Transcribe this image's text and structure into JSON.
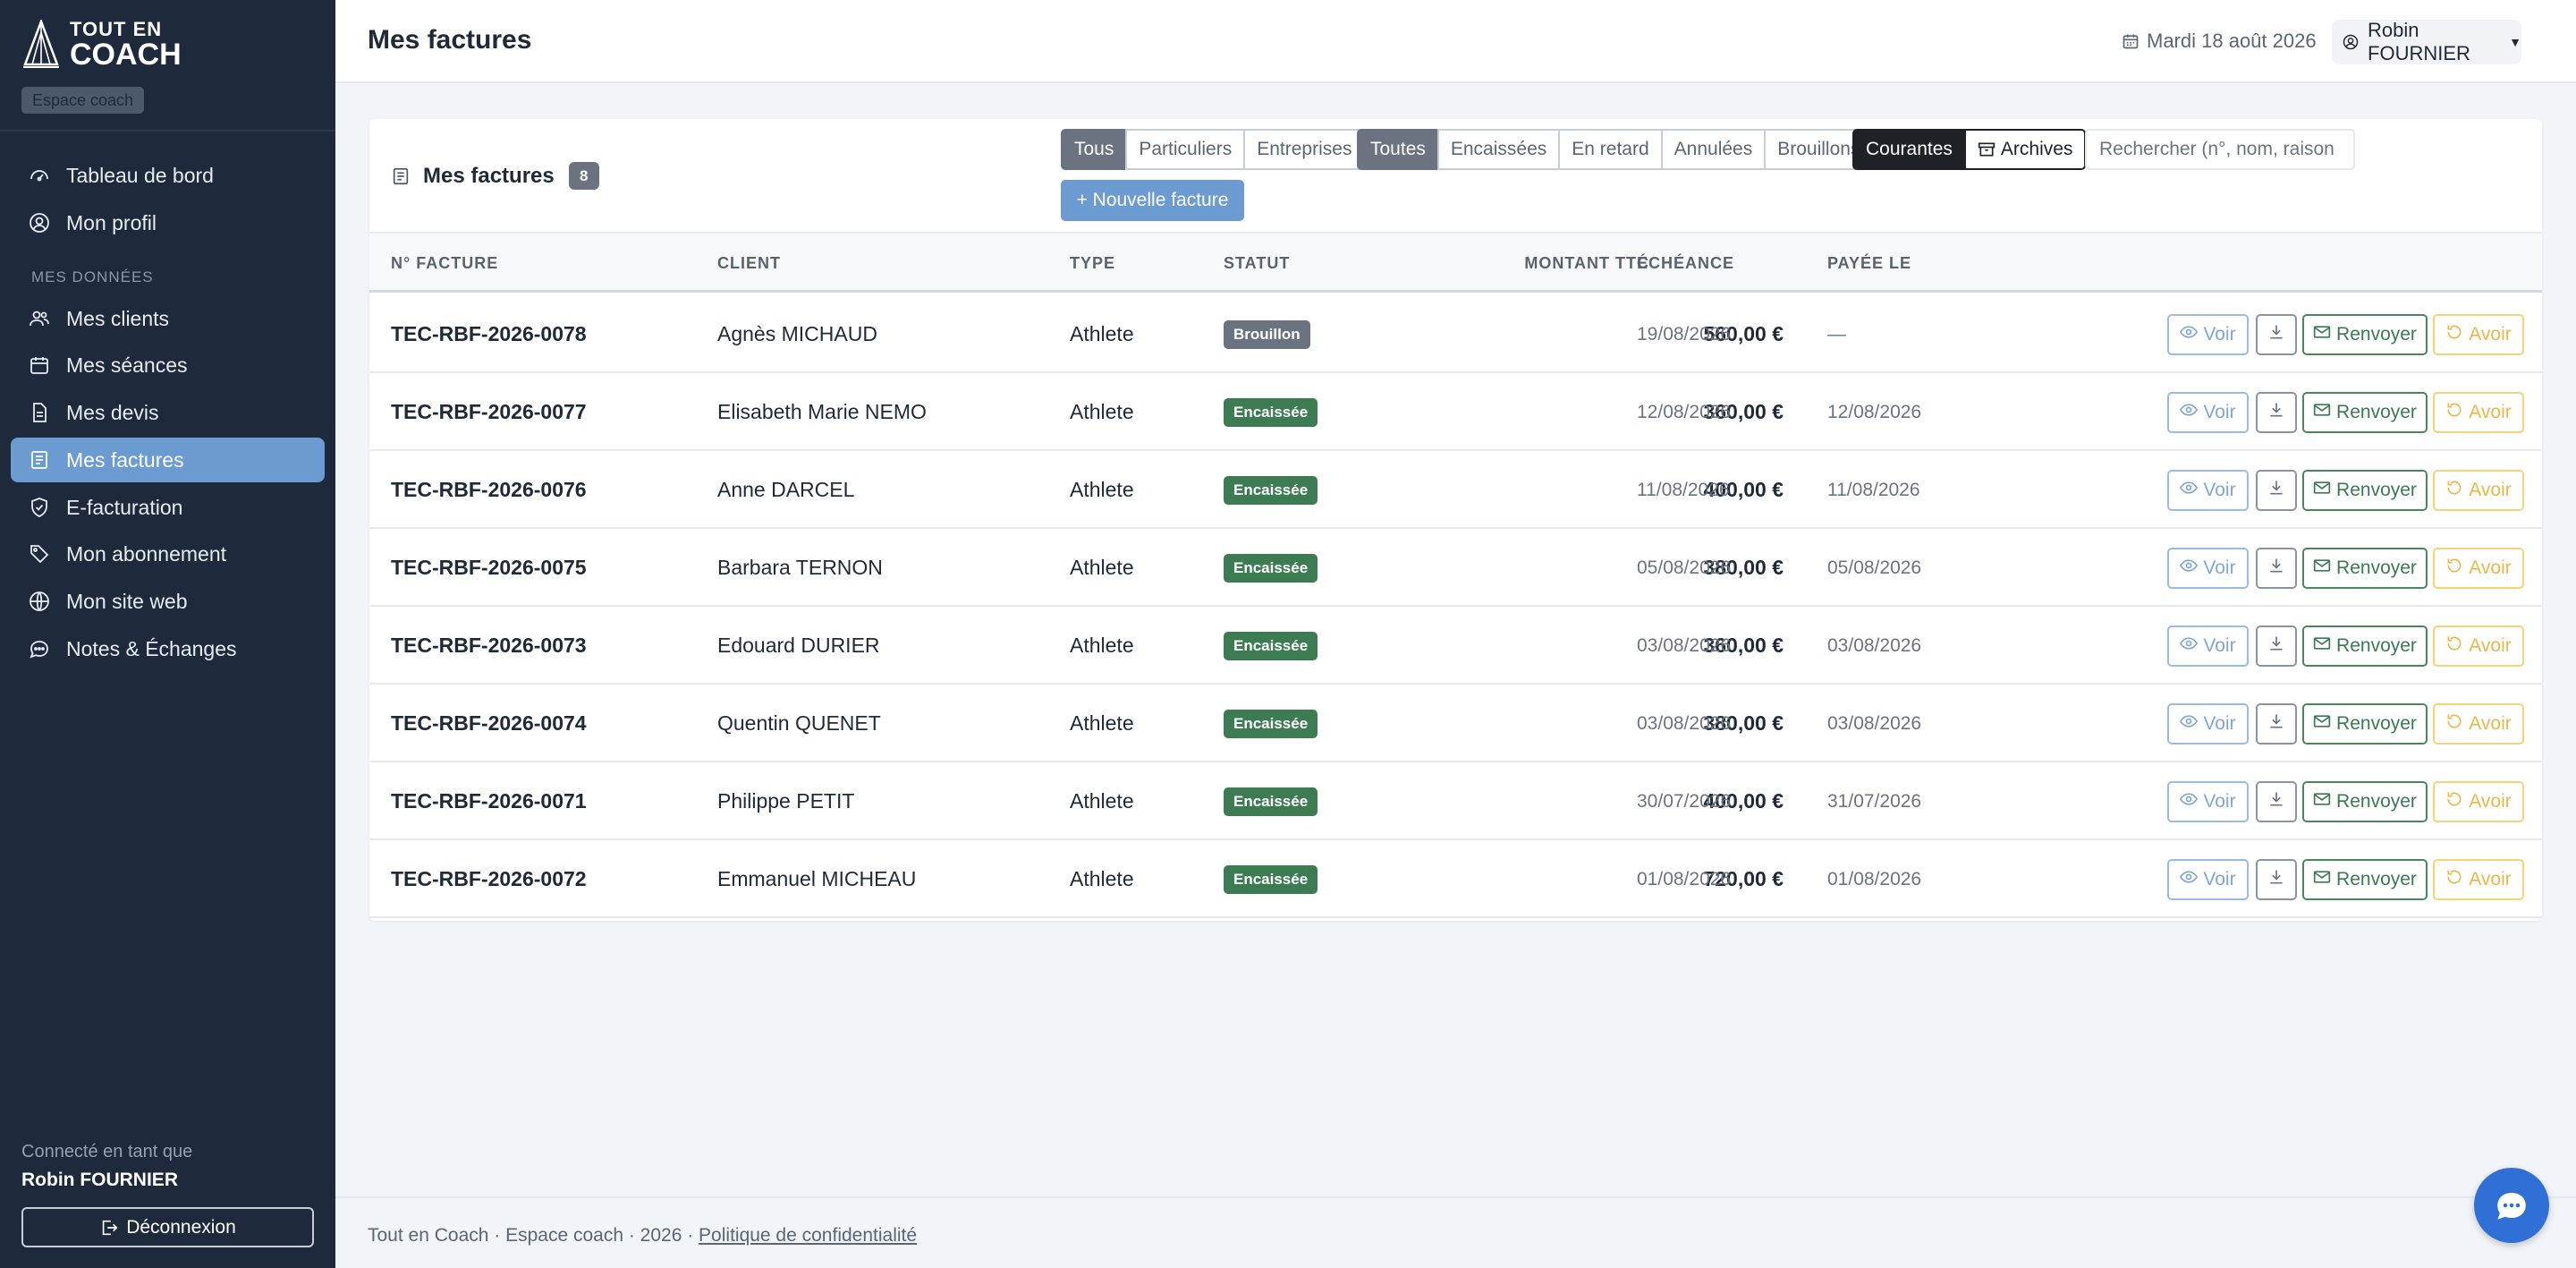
{
  "brand": {
    "line1": "TOUT EN",
    "line2": "COACH",
    "space_badge": "Espace coach"
  },
  "sidebar": {
    "items": [
      {
        "label": "Tableau de bord",
        "icon": "dashboard-icon"
      },
      {
        "label": "Mon profil",
        "icon": "user-circle-icon"
      },
      {
        "label": "Mes clients",
        "icon": "users-icon"
      },
      {
        "label": "Mes séances",
        "icon": "calendar-icon"
      },
      {
        "label": "Mes devis",
        "icon": "document-icon"
      },
      {
        "label": "Mes factures",
        "icon": "invoice-icon",
        "active": true
      },
      {
        "label": "E-facturation",
        "icon": "shield-check-icon"
      },
      {
        "label": "Mon abonnement",
        "icon": "tags-icon"
      },
      {
        "label": "Mon site web",
        "icon": "globe-icon"
      },
      {
        "label": "Notes & Échanges",
        "icon": "chat-icon"
      }
    ],
    "section_label": "MES DONNÉES",
    "connected_label": "Connecté en tant que",
    "user_name": "Robin FOURNIER",
    "logout_label": "Déconnexion"
  },
  "header": {
    "title": "Mes factures",
    "date": "Mardi 18 août 2026",
    "user": "Robin FOURNIER"
  },
  "card": {
    "title": "Mes factures",
    "count": "8",
    "filters_type": [
      "Tous",
      "Particuliers",
      "Entreprises"
    ],
    "filters_status": [
      "Toutes",
      "Encaissées",
      "En retard",
      "Annulées",
      "Brouillons"
    ],
    "filters_view": [
      "Courantes",
      "Archives"
    ],
    "search_placeholder": "Rechercher (n°, nom, raison",
    "new_button": "+ Nouvelle facture"
  },
  "table": {
    "columns": [
      "N° FACTURE",
      "CLIENT",
      "TYPE",
      "STATUT",
      "MONTANT TTC",
      "ÉCHÉANCE",
      "PAYÉE LE"
    ],
    "actions": {
      "view": "Voir",
      "resend": "Renvoyer",
      "credit": "Avoir"
    },
    "rows": [
      {
        "num": "TEC-RBF-2026-0078",
        "client": "Agnès MICHAUD",
        "type": "Athlete",
        "status": "Brouillon",
        "status_color": "#6b7280",
        "amount": "560,00 €",
        "due": "19/08/2026",
        "paid": "—"
      },
      {
        "num": "TEC-RBF-2026-0077",
        "client": "Elisabeth Marie NEMO",
        "type": "Athlete",
        "status": "Encaissée",
        "status_color": "#3d7c53",
        "amount": "360,00 €",
        "due": "12/08/2026",
        "paid": "12/08/2026"
      },
      {
        "num": "TEC-RBF-2026-0076",
        "client": "Anne DARCEL",
        "type": "Athlete",
        "status": "Encaissée",
        "status_color": "#3d7c53",
        "amount": "400,00 €",
        "due": "11/08/2026",
        "paid": "11/08/2026"
      },
      {
        "num": "TEC-RBF-2026-0075",
        "client": "Barbara TERNON",
        "type": "Athlete",
        "status": "Encaissée",
        "status_color": "#3d7c53",
        "amount": "380,00 €",
        "due": "05/08/2026",
        "paid": "05/08/2026"
      },
      {
        "num": "TEC-RBF-2026-0073",
        "client": "Edouard DURIER",
        "type": "Athlete",
        "status": "Encaissée",
        "status_color": "#3d7c53",
        "amount": "360,00 €",
        "due": "03/08/2026",
        "paid": "03/08/2026"
      },
      {
        "num": "TEC-RBF-2026-0074",
        "client": "Quentin QUENET",
        "type": "Athlete",
        "status": "Encaissée",
        "status_color": "#3d7c53",
        "amount": "380,00 €",
        "due": "03/08/2026",
        "paid": "03/08/2026"
      },
      {
        "num": "TEC-RBF-2026-0071",
        "client": "Philippe PETIT",
        "type": "Athlete",
        "status": "Encaissée",
        "status_color": "#3d7c53",
        "amount": "400,00 €",
        "due": "30/07/2026",
        "paid": "31/07/2026"
      },
      {
        "num": "TEC-RBF-2026-0072",
        "client": "Emmanuel MICHEAU",
        "type": "Athlete",
        "status": "Encaissée",
        "status_color": "#3d7c53",
        "amount": "720,00 €",
        "due": "01/08/2026",
        "paid": "01/08/2026"
      }
    ]
  },
  "footer": {
    "text": "Tout en Coach · Espace coach · 2026 · ",
    "link": "Politique de confidentialité"
  }
}
